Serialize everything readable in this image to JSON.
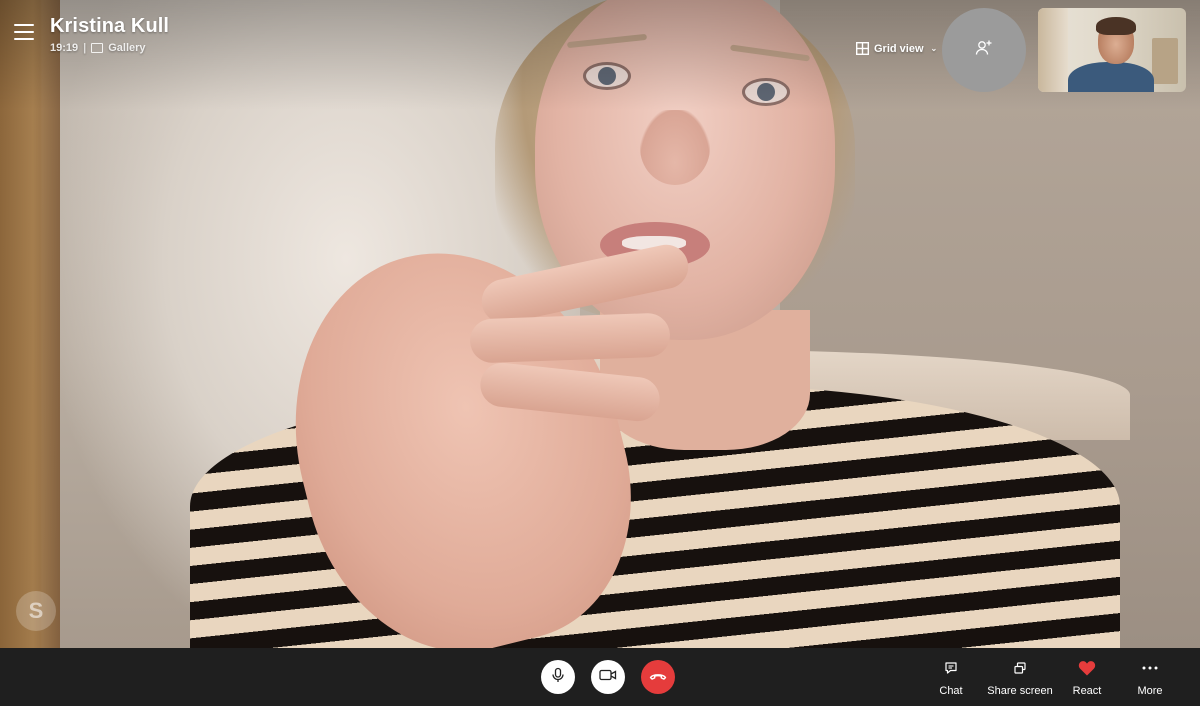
{
  "call": {
    "caller_name": "Kristina Kull",
    "time": "19:19",
    "separator": "|",
    "layout_label": "Gallery"
  },
  "header": {
    "grid_view_label": "Grid view",
    "menu_icon": "hamburger-icon",
    "add_people_icon": "add-person-icon"
  },
  "watermark": {
    "letter": "S",
    "icon": "skype-logo"
  },
  "controls": {
    "mic_icon": "microphone-icon",
    "camera_icon": "video-camera-icon",
    "hangup_icon": "hang-up-icon",
    "hangup_color": "#e53c3c"
  },
  "actions": {
    "chat_label": "Chat",
    "share_label": "Share screen",
    "react_label": "React",
    "more_label": "More",
    "react_color": "#e53c3c"
  }
}
